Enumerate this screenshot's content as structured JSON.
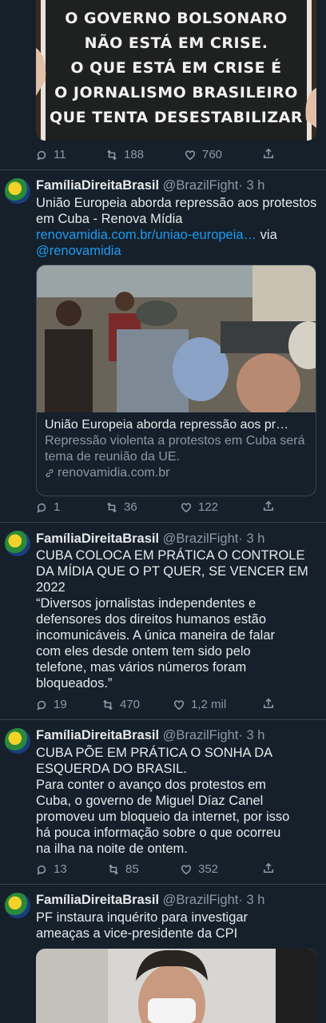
{
  "tweet0": {
    "image_text": [
      "O GOVERNO BOLSONARO",
      "NÃO ESTÁ EM CRISE.",
      "O QUE ESTÁ EM CRISE É",
      "O JORNALISMO BRASILEIRO",
      "QUE TENTA DESESTABILIZAR"
    ],
    "replies": "11",
    "retweets": "188",
    "likes": "760"
  },
  "tweet1": {
    "name": "FamíliaDireitaBrasil",
    "handle": "@BrazilFight",
    "time": "· 3 h",
    "text": "União Europeia aborda repressão aos protestos em Cuba - Renova Mídia",
    "link_url": "renovamidia.com.br/uniao-europeia…",
    "via": " via",
    "mention": "@renovamidia",
    "card_title": "União Europeia aborda repressão aos pr…",
    "card_desc": "Repressão violenta a protestos em Cuba será tema de reunião da UE.",
    "card_domain": "renovamidia.com.br",
    "replies": "1",
    "retweets": "36",
    "likes": "122"
  },
  "tweet2": {
    "name": "FamíliaDireitaBrasil",
    "handle": "@BrazilFight",
    "time": "· 3 h",
    "text_lines": [
      "CUBA COLOCA EM PRÁTICA O CONTROLE",
      "DA MÍDIA QUE O PT QUER, SE VENCER EM",
      "2022",
      "“Diversos jornalistas independentes e",
      "defensores dos direitos humanos estão",
      "incomunicáveis. A única maneira de falar",
      "com eles desde ontem tem sido pelo",
      "telefone, mas vários números foram",
      "bloqueados.”"
    ],
    "replies": "19",
    "retweets": "470",
    "likes": "1,2 mil"
  },
  "tweet3": {
    "name": "FamíliaDireitaBrasil",
    "handle": "@BrazilFight",
    "time": "· 3 h",
    "text_lines": [
      "CUBA PÕE EM PRÁTICA O SONHA DA",
      "ESQUERDA DO BRASIL.",
      "Para conter o avanço dos protestos em",
      "Cuba, o governo de Miguel Díaz Canel",
      "promoveu um bloqueio da internet, por isso",
      "há pouca informação sobre o que ocorreu",
      "na ilha na noite de ontem."
    ],
    "replies": "13",
    "retweets": "85",
    "likes": "352"
  },
  "tweet4": {
    "name": "FamíliaDireitaBrasil",
    "handle": "@BrazilFight",
    "time": "· 3 h",
    "text_lines": [
      "PF instaura inquérito para investigar",
      "ameaças a vice-presidente da CPI"
    ]
  }
}
